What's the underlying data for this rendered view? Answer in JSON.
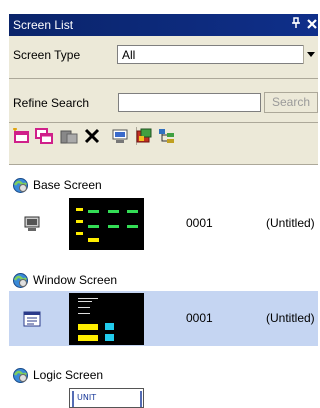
{
  "panel": {
    "title": "Screen List",
    "pin_glyph": "p",
    "close_glyph": "×"
  },
  "filter": {
    "screen_type_label": "Screen Type",
    "screen_type_value": "All",
    "refine_label": "Refine Search",
    "search_value": "",
    "search_button": "Search"
  },
  "toolbar": {
    "icons": [
      "new-screen-icon",
      "copy-screen-icon",
      "paste-screen-icon",
      "delete-icon",
      "monitor-icon",
      "properties-icon",
      "tree-view-icon"
    ]
  },
  "groups": [
    {
      "label": "Base Screen",
      "items": [
        {
          "number": "0001",
          "name": "(Untitled)",
          "selected": false
        }
      ]
    },
    {
      "label": "Window Screen",
      "items": [
        {
          "number": "0001",
          "name": "(Untitled)",
          "selected": true
        }
      ]
    },
    {
      "label": "Logic Screen",
      "items": [
        {
          "thumb_text": "UNIT"
        }
      ]
    }
  ],
  "colors": {
    "titlebar": "#0a246a",
    "selected_row": "#c5d5f2",
    "thumb_green": "#33dd55",
    "thumb_yellow": "#ffee00",
    "thumb_cyan": "#22cced"
  }
}
